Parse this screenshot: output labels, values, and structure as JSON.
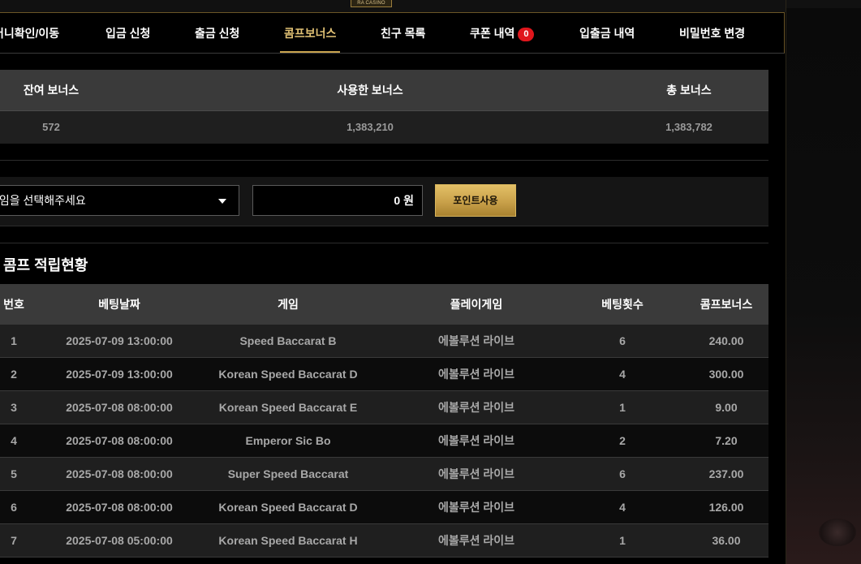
{
  "logo_text": "RA CASINO",
  "nav": {
    "items": [
      {
        "label": "머니확인/이동"
      },
      {
        "label": "입금 신청"
      },
      {
        "label": "출금 신청"
      },
      {
        "label": "콤프보너스",
        "active": true
      },
      {
        "label": "친구 목록"
      },
      {
        "label": "쿠폰 내역",
        "badge": "0"
      },
      {
        "label": "입출금 내역"
      },
      {
        "label": "비밀번호 변경"
      }
    ]
  },
  "summary": {
    "headers": [
      "잔여 보너스",
      "사용한 보너스",
      "총 보너스"
    ],
    "values": [
      "572",
      "1,383,210",
      "1,383,782"
    ]
  },
  "form": {
    "select_placeholder": "게임을 선택해주세요",
    "amount_value": "0",
    "amount_unit": "원",
    "button_label": "포인트사용"
  },
  "section_title": "콤프 적립현황",
  "table": {
    "headers": [
      "번호",
      "베팅날짜",
      "게임",
      "플레이게임",
      "베팅횟수",
      "콤프보너스"
    ],
    "rows": [
      [
        "1",
        "2025-07-09 13:00:00",
        "Speed Baccarat B",
        "에볼루션 라이브",
        "6",
        "240.00"
      ],
      [
        "2",
        "2025-07-09 13:00:00",
        "Korean Speed Baccarat D",
        "에볼루션 라이브",
        "4",
        "300.00"
      ],
      [
        "3",
        "2025-07-08 08:00:00",
        "Korean Speed Baccarat E",
        "에볼루션 라이브",
        "1",
        "9.00"
      ],
      [
        "4",
        "2025-07-08 08:00:00",
        "Emperor Sic Bo",
        "에볼루션 라이브",
        "2",
        "7.20"
      ],
      [
        "5",
        "2025-07-08 08:00:00",
        "Super Speed Baccarat",
        "에볼루션 라이브",
        "6",
        "237.00"
      ],
      [
        "6",
        "2025-07-08 08:00:00",
        "Korean Speed Baccarat D",
        "에볼루션 라이브",
        "4",
        "126.00"
      ],
      [
        "7",
        "2025-07-08 05:00:00",
        "Korean Speed Baccarat H",
        "에볼루션 라이브",
        "1",
        "36.00"
      ]
    ]
  },
  "colors": {
    "accent_gold": "#c9a44e",
    "badge_red": "#e0161c",
    "header_bg": "#3a3a3a"
  }
}
